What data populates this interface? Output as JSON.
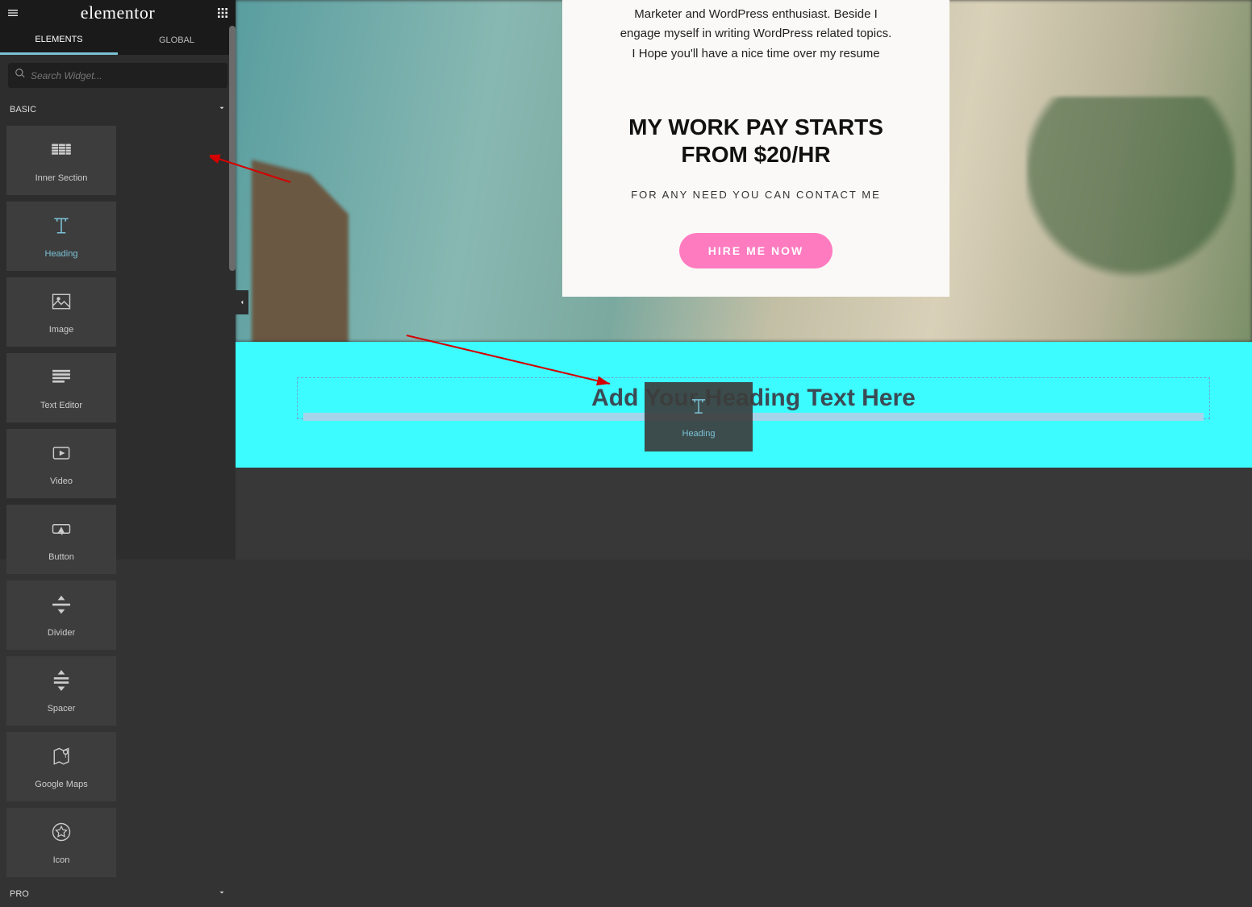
{
  "brand": "elementor",
  "tabs": {
    "elements": "ELEMENTS",
    "global": "GLOBAL"
  },
  "search": {
    "placeholder": "Search Widget..."
  },
  "categories": {
    "basic": "BASIC",
    "pro": "PRO"
  },
  "widgets": {
    "inner_section": "Inner Section",
    "heading": "Heading",
    "image": "Image",
    "text_editor": "Text Editor",
    "video": "Video",
    "button": "Button",
    "divider": "Divider",
    "spacer": "Spacer",
    "google_maps": "Google Maps",
    "icon": "Icon"
  },
  "preview": {
    "intro_line1": "Marketer and WordPress enthusiast. Beside I",
    "intro_line2": "engage myself in writing WordPress related topics.",
    "intro_line3": "I Hope you'll have a nice time over my resume",
    "headline_line1": "MY WORK PAY STARTS",
    "headline_line2": "FROM $20/HR",
    "subhead": "FOR ANY NEED YOU CAN CONTACT ME",
    "cta": "HIRE ME NOW",
    "placeholder_heading": "Add Your Heading Text Here"
  },
  "drag_ghost": {
    "label": "Heading"
  }
}
